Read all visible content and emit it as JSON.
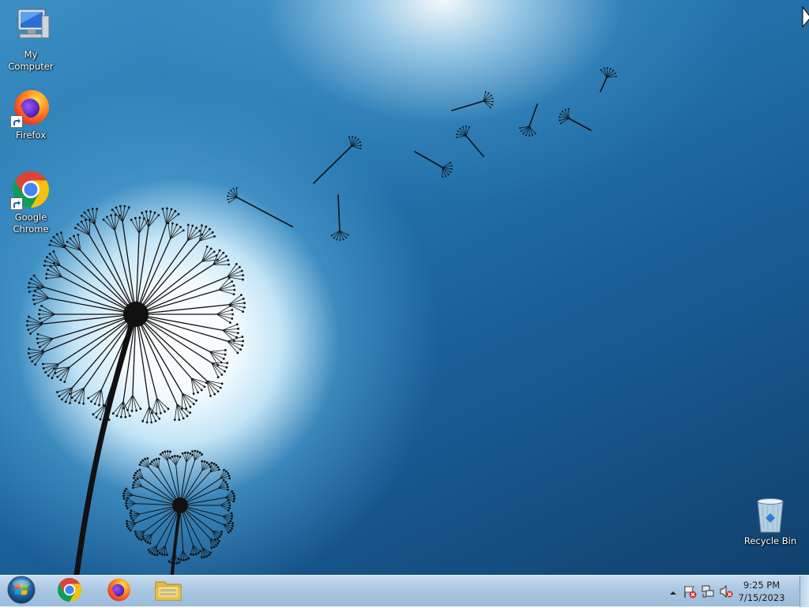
{
  "desktop": {
    "icons": [
      {
        "label": "My Computer",
        "icon": "computer-icon"
      },
      {
        "label": "Firefox",
        "icon": "firefox-icon",
        "shortcut": true
      },
      {
        "label": "Google Chrome",
        "icon": "chrome-icon",
        "shortcut": true
      },
      {
        "label": "Recycle Bin",
        "icon": "recycle-bin-icon"
      }
    ]
  },
  "taskbar": {
    "start": {
      "icon": "windows-start-orb-icon"
    },
    "pinned": [
      {
        "icon": "chrome-icon"
      },
      {
        "icon": "firefox-icon"
      },
      {
        "icon": "file-explorer-folder-icon"
      }
    ],
    "tray": {
      "icons": [
        "show-hidden-icons-arrow-icon",
        "action-center-flag-icon",
        "network-icon",
        "volume-muted-icon"
      ],
      "time": "9:25 PM",
      "date": "7/15/2023"
    }
  },
  "colors": {
    "taskbar": "#aac7e2",
    "wallpaper_dark": "#144c7e",
    "wallpaper_light": "#3b8fc4",
    "chrome_red": "#db4437",
    "chrome_yellow": "#f4c20d",
    "chrome_green": "#0f9d58",
    "chrome_blue": "#4285f4"
  }
}
